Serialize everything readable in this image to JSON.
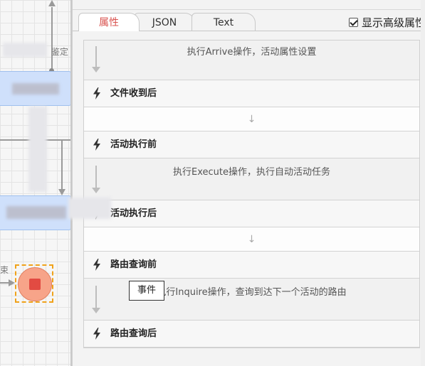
{
  "canvas": {
    "top_label": "鉴定",
    "end_label": "束"
  },
  "tabs": [
    {
      "label": "属性",
      "active": true
    },
    {
      "label": "JSON",
      "active": false
    },
    {
      "label": "Text",
      "active": false
    }
  ],
  "advanced_toggle": {
    "label": "显示高级属性",
    "checked": true
  },
  "events": [
    {
      "kind": "desc",
      "text": "执行Arrive操作，活动属性设置"
    },
    {
      "kind": "event",
      "label": "文件收到后"
    },
    {
      "kind": "sep",
      "text": "↓"
    },
    {
      "kind": "event",
      "label": "活动执行前"
    },
    {
      "kind": "desc",
      "text": "执行Execute操作，执行自动活动任务"
    },
    {
      "kind": "event",
      "label": "活动执行后"
    },
    {
      "kind": "sep",
      "text": "↓"
    },
    {
      "kind": "event",
      "label": "路由查询前"
    },
    {
      "kind": "desc",
      "text": "执行Inquire操作，查询到达下一个活动的路由"
    },
    {
      "kind": "event",
      "label": "路由查询后"
    }
  ],
  "tooltip": "事件",
  "icons": {
    "event": "lightning-icon",
    "flow": "down-arrow-icon",
    "checkbox": "checkbox-checked-icon"
  },
  "colors": {
    "active_tab": "#d9534f",
    "end_node_fill": "#f7a489",
    "end_node_stop": "#e24b42",
    "selection_border": "#f0a21a",
    "activity_node": "#cfe0fb"
  }
}
